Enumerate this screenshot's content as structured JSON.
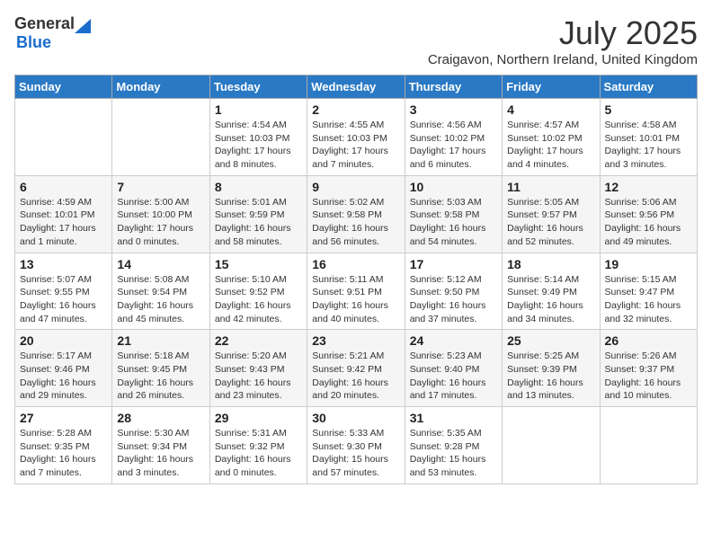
{
  "header": {
    "logo_general": "General",
    "logo_blue": "Blue",
    "month_year": "July 2025",
    "location": "Craigavon, Northern Ireland, United Kingdom"
  },
  "columns": [
    "Sunday",
    "Monday",
    "Tuesday",
    "Wednesday",
    "Thursday",
    "Friday",
    "Saturday"
  ],
  "weeks": [
    [
      {
        "day": "",
        "info": ""
      },
      {
        "day": "",
        "info": ""
      },
      {
        "day": "1",
        "info": "Sunrise: 4:54 AM\nSunset: 10:03 PM\nDaylight: 17 hours\nand 8 minutes."
      },
      {
        "day": "2",
        "info": "Sunrise: 4:55 AM\nSunset: 10:03 PM\nDaylight: 17 hours\nand 7 minutes."
      },
      {
        "day": "3",
        "info": "Sunrise: 4:56 AM\nSunset: 10:02 PM\nDaylight: 17 hours\nand 6 minutes."
      },
      {
        "day": "4",
        "info": "Sunrise: 4:57 AM\nSunset: 10:02 PM\nDaylight: 17 hours\nand 4 minutes."
      },
      {
        "day": "5",
        "info": "Sunrise: 4:58 AM\nSunset: 10:01 PM\nDaylight: 17 hours\nand 3 minutes."
      }
    ],
    [
      {
        "day": "6",
        "info": "Sunrise: 4:59 AM\nSunset: 10:01 PM\nDaylight: 17 hours\nand 1 minute."
      },
      {
        "day": "7",
        "info": "Sunrise: 5:00 AM\nSunset: 10:00 PM\nDaylight: 17 hours\nand 0 minutes."
      },
      {
        "day": "8",
        "info": "Sunrise: 5:01 AM\nSunset: 9:59 PM\nDaylight: 16 hours\nand 58 minutes."
      },
      {
        "day": "9",
        "info": "Sunrise: 5:02 AM\nSunset: 9:58 PM\nDaylight: 16 hours\nand 56 minutes."
      },
      {
        "day": "10",
        "info": "Sunrise: 5:03 AM\nSunset: 9:58 PM\nDaylight: 16 hours\nand 54 minutes."
      },
      {
        "day": "11",
        "info": "Sunrise: 5:05 AM\nSunset: 9:57 PM\nDaylight: 16 hours\nand 52 minutes."
      },
      {
        "day": "12",
        "info": "Sunrise: 5:06 AM\nSunset: 9:56 PM\nDaylight: 16 hours\nand 49 minutes."
      }
    ],
    [
      {
        "day": "13",
        "info": "Sunrise: 5:07 AM\nSunset: 9:55 PM\nDaylight: 16 hours\nand 47 minutes."
      },
      {
        "day": "14",
        "info": "Sunrise: 5:08 AM\nSunset: 9:54 PM\nDaylight: 16 hours\nand 45 minutes."
      },
      {
        "day": "15",
        "info": "Sunrise: 5:10 AM\nSunset: 9:52 PM\nDaylight: 16 hours\nand 42 minutes."
      },
      {
        "day": "16",
        "info": "Sunrise: 5:11 AM\nSunset: 9:51 PM\nDaylight: 16 hours\nand 40 minutes."
      },
      {
        "day": "17",
        "info": "Sunrise: 5:12 AM\nSunset: 9:50 PM\nDaylight: 16 hours\nand 37 minutes."
      },
      {
        "day": "18",
        "info": "Sunrise: 5:14 AM\nSunset: 9:49 PM\nDaylight: 16 hours\nand 34 minutes."
      },
      {
        "day": "19",
        "info": "Sunrise: 5:15 AM\nSunset: 9:47 PM\nDaylight: 16 hours\nand 32 minutes."
      }
    ],
    [
      {
        "day": "20",
        "info": "Sunrise: 5:17 AM\nSunset: 9:46 PM\nDaylight: 16 hours\nand 29 minutes."
      },
      {
        "day": "21",
        "info": "Sunrise: 5:18 AM\nSunset: 9:45 PM\nDaylight: 16 hours\nand 26 minutes."
      },
      {
        "day": "22",
        "info": "Sunrise: 5:20 AM\nSunset: 9:43 PM\nDaylight: 16 hours\nand 23 minutes."
      },
      {
        "day": "23",
        "info": "Sunrise: 5:21 AM\nSunset: 9:42 PM\nDaylight: 16 hours\nand 20 minutes."
      },
      {
        "day": "24",
        "info": "Sunrise: 5:23 AM\nSunset: 9:40 PM\nDaylight: 16 hours\nand 17 minutes."
      },
      {
        "day": "25",
        "info": "Sunrise: 5:25 AM\nSunset: 9:39 PM\nDaylight: 16 hours\nand 13 minutes."
      },
      {
        "day": "26",
        "info": "Sunrise: 5:26 AM\nSunset: 9:37 PM\nDaylight: 16 hours\nand 10 minutes."
      }
    ],
    [
      {
        "day": "27",
        "info": "Sunrise: 5:28 AM\nSunset: 9:35 PM\nDaylight: 16 hours\nand 7 minutes."
      },
      {
        "day": "28",
        "info": "Sunrise: 5:30 AM\nSunset: 9:34 PM\nDaylight: 16 hours\nand 3 minutes."
      },
      {
        "day": "29",
        "info": "Sunrise: 5:31 AM\nSunset: 9:32 PM\nDaylight: 16 hours\nand 0 minutes."
      },
      {
        "day": "30",
        "info": "Sunrise: 5:33 AM\nSunset: 9:30 PM\nDaylight: 15 hours\nand 57 minutes."
      },
      {
        "day": "31",
        "info": "Sunrise: 5:35 AM\nSunset: 9:28 PM\nDaylight: 15 hours\nand 53 minutes."
      },
      {
        "day": "",
        "info": ""
      },
      {
        "day": "",
        "info": ""
      }
    ]
  ]
}
